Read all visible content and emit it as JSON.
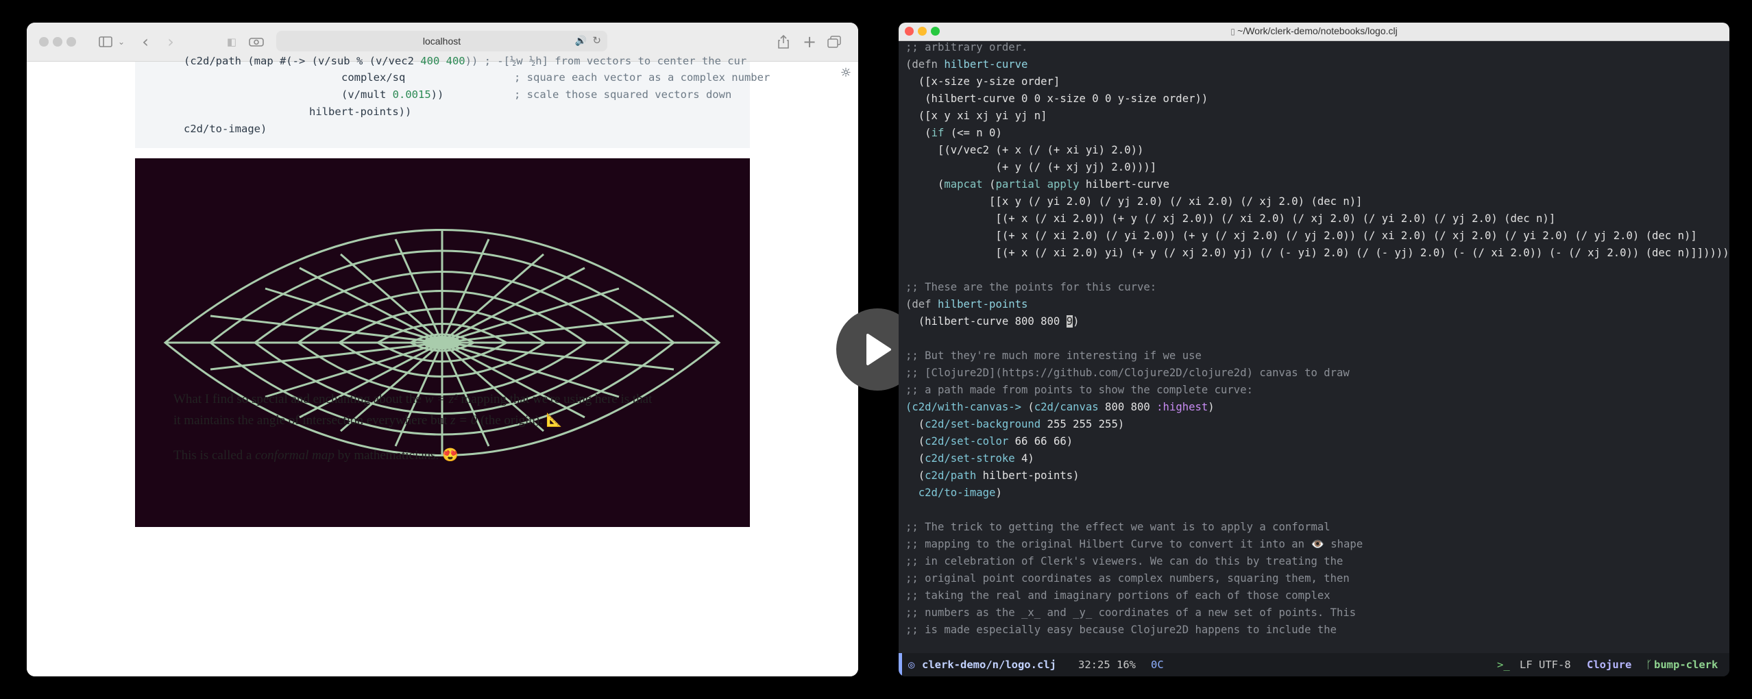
{
  "browser": {
    "url": "localhost",
    "code": {
      "line1_pre": "(c2d/path (map #(-> (v/sub % (v/vec2 ",
      "line1_n1": "400",
      "line1_sp": " ",
      "line1_n2": "400",
      "line1_post": ")) ; -[½w ½h] from vectors to center the cur",
      "line2": "complex/sq",
      "line2_comment": "; square each vector as a complex number",
      "line3_pre": "(v/mult ",
      "line3_num": "0.0015",
      "line3_post": "))",
      "line3_comment": "; scale those squared vectors down",
      "line4": "hilbert-points))",
      "line5": "c2d/to-image)"
    },
    "prose": {
      "p1a_pre": "What I find so special and enchanting about the ",
      "p1a_math": "w = z²",
      "p1a_post": " mapping that we're using here is that",
      "p1b_pre": "it maintains the angle of intersection everywhere but ",
      "p1b_math": "z = 0",
      "p1b_post": " (the origin). 📐",
      "p2_pre": "This is called a ",
      "p2_em": "conformal map",
      "p2_post": " by mathematicians. 😍"
    }
  },
  "editor": {
    "title": "~/Work/clerk-demo/notebooks/logo.clj",
    "lines": {
      "l1": ";; arbitrary order.",
      "l2a": "(defn ",
      "l2b": "hilbert-curve",
      "l3": "  ([x-size y-size order]",
      "l4": "   (hilbert-curve 0 0 x-size 0 0 y-size order))",
      "l5": "  ([x y xi xj yi yj n]",
      "l6a": "   (",
      "l6b": "if",
      "l6c": " (<= n 0)",
      "l7": "     [(v/vec2 (+ x (/ (+ xi yi) 2.0))",
      "l8": "              (+ y (/ (+ xj yj) 2.0)))]",
      "l9a": "     (",
      "l9b": "mapcat",
      "l9c": " (",
      "l9d": "partial",
      "l9e": " ",
      "l9f": "apply",
      "l9g": " hilbert-curve",
      "l10": "             [[x y (/ yi 2.0) (/ yj 2.0) (/ xi 2.0) (/ xj 2.0) (dec n)]",
      "l11": "              [(+ x (/ xi 2.0)) (+ y (/ xj 2.0)) (/ xi 2.0) (/ xj 2.0) (/ yi 2.0) (/ yj 2.0) (dec n)]",
      "l12": "              [(+ x (/ xi 2.0) (/ yi 2.0)) (+ y (/ xj 2.0) (/ yj 2.0)) (/ xi 2.0) (/ xj 2.0) (/ yi 2.0) (/ yj 2.0) (dec n)]",
      "l13": "              [(+ x (/ xi 2.0) yi) (+ y (/ xj 2.0) yj) (/ (- yi) 2.0) (/ (- yj) 2.0) (- (/ xi 2.0)) (- (/ xj 2.0)) (dec n)]]))))",
      "l14": ";; These are the points for this curve:",
      "l15a": "(def ",
      "l15b": "hilbert-points",
      "l16a": "  (hilbert-curve 800 800 ",
      "l16cur": "9",
      "l16b": ")",
      "l17": ";; But they're much more interesting if we use",
      "l18": ";; [Clojure2D](https://github.com/Clojure2D/clojure2d) canvas to draw",
      "l19": ";; a path made from points to show the complete curve:",
      "l20a": "(c2d/with-canvas->",
      "l20b": " (",
      "l20c": "c2d/canvas",
      "l20d": " 800 800 ",
      "l20e": ":highest",
      "l20f": ")",
      "l21a": "  (",
      "l21b": "c2d/set-background",
      "l21c": " 255 255 255)",
      "l22a": "  (",
      "l22b": "c2d/set-color",
      "l22c": " 66 66 66)",
      "l23a": "  (",
      "l23b": "c2d/set-stroke",
      "l23c": " 4)",
      "l24a": "  (",
      "l24b": "c2d/path",
      "l24c": " hilbert-points)",
      "l25a": "  ",
      "l25b": "c2d/to-image",
      "l25c": ")",
      "l26": ";; The trick to getting the effect we want is to apply a conformal",
      "l27": ";; mapping to the original Hilbert Curve to convert it into an 👁️ shape",
      "l28": ";; in celebration of Clerk's viewers. We can do this by treating the",
      "l29": ";; original point coordinates as complex numbers, squaring them, then",
      "l30": ";; taking the real and imaginary portions of each of those complex",
      "l31": ";; numbers as the _x_ and _y_ coordinates of a new set of points. This",
      "l32": ";; is made especially easy because Clojure2D happens to include the"
    },
    "status": {
      "file": "clerk-demo/n/logo.clj",
      "pos": "32:25 16%",
      "oc": "0C",
      "prompt": ">_",
      "enc": "LF UTF-8",
      "lang": "Clojure",
      "branch": "bump-clerk"
    }
  }
}
